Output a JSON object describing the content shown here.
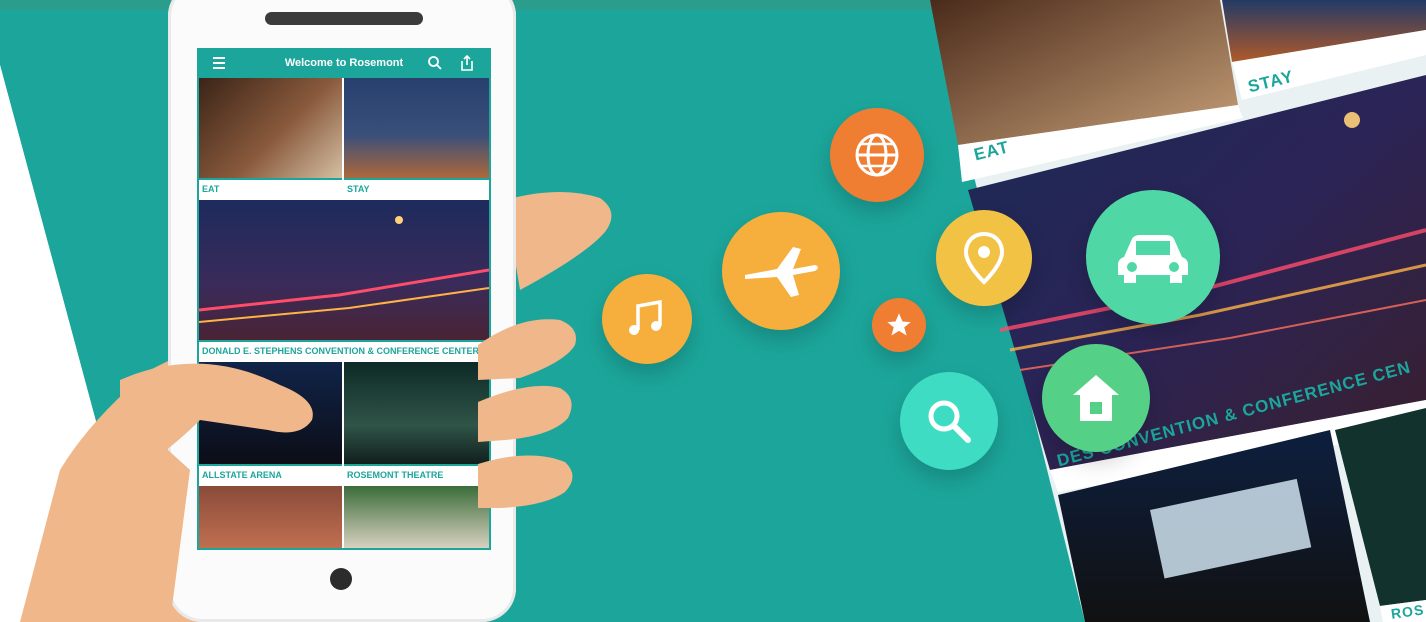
{
  "phone": {
    "app_title": "Welcome to Rosemont",
    "tiles": [
      {
        "label": "EAT"
      },
      {
        "label": "STAY"
      },
      {
        "label": "DONALD E. STEPHENS CONVENTION & CONFERENCE CENTER"
      },
      {
        "label": "ALLSTATE ARENA"
      },
      {
        "label": "ROSEMONT THEATRE"
      }
    ]
  },
  "collage": {
    "labels": {
      "eat": "EAT",
      "stay": "STAY",
      "convention": "DES CONVENTION & CONFERENCE CEN",
      "cut": "ROS"
    }
  },
  "icons": [
    {
      "name": "music-note-icon",
      "color": "#f6ae3c"
    },
    {
      "name": "airplane-icon",
      "color": "#f6ae3c"
    },
    {
      "name": "globe-icon",
      "color": "#f07e32"
    },
    {
      "name": "star-icon",
      "color": "#f07e32"
    },
    {
      "name": "location-pin-icon",
      "color": "#f2c244"
    },
    {
      "name": "search-icon",
      "color": "#3fdcc4"
    },
    {
      "name": "car-icon",
      "color": "#4fd8a6"
    },
    {
      "name": "home-icon",
      "color": "#55d187"
    }
  ],
  "colors": {
    "teal_background": "#1ca69b",
    "accent": "#1ca69b",
    "skin": "#f0b78a"
  }
}
